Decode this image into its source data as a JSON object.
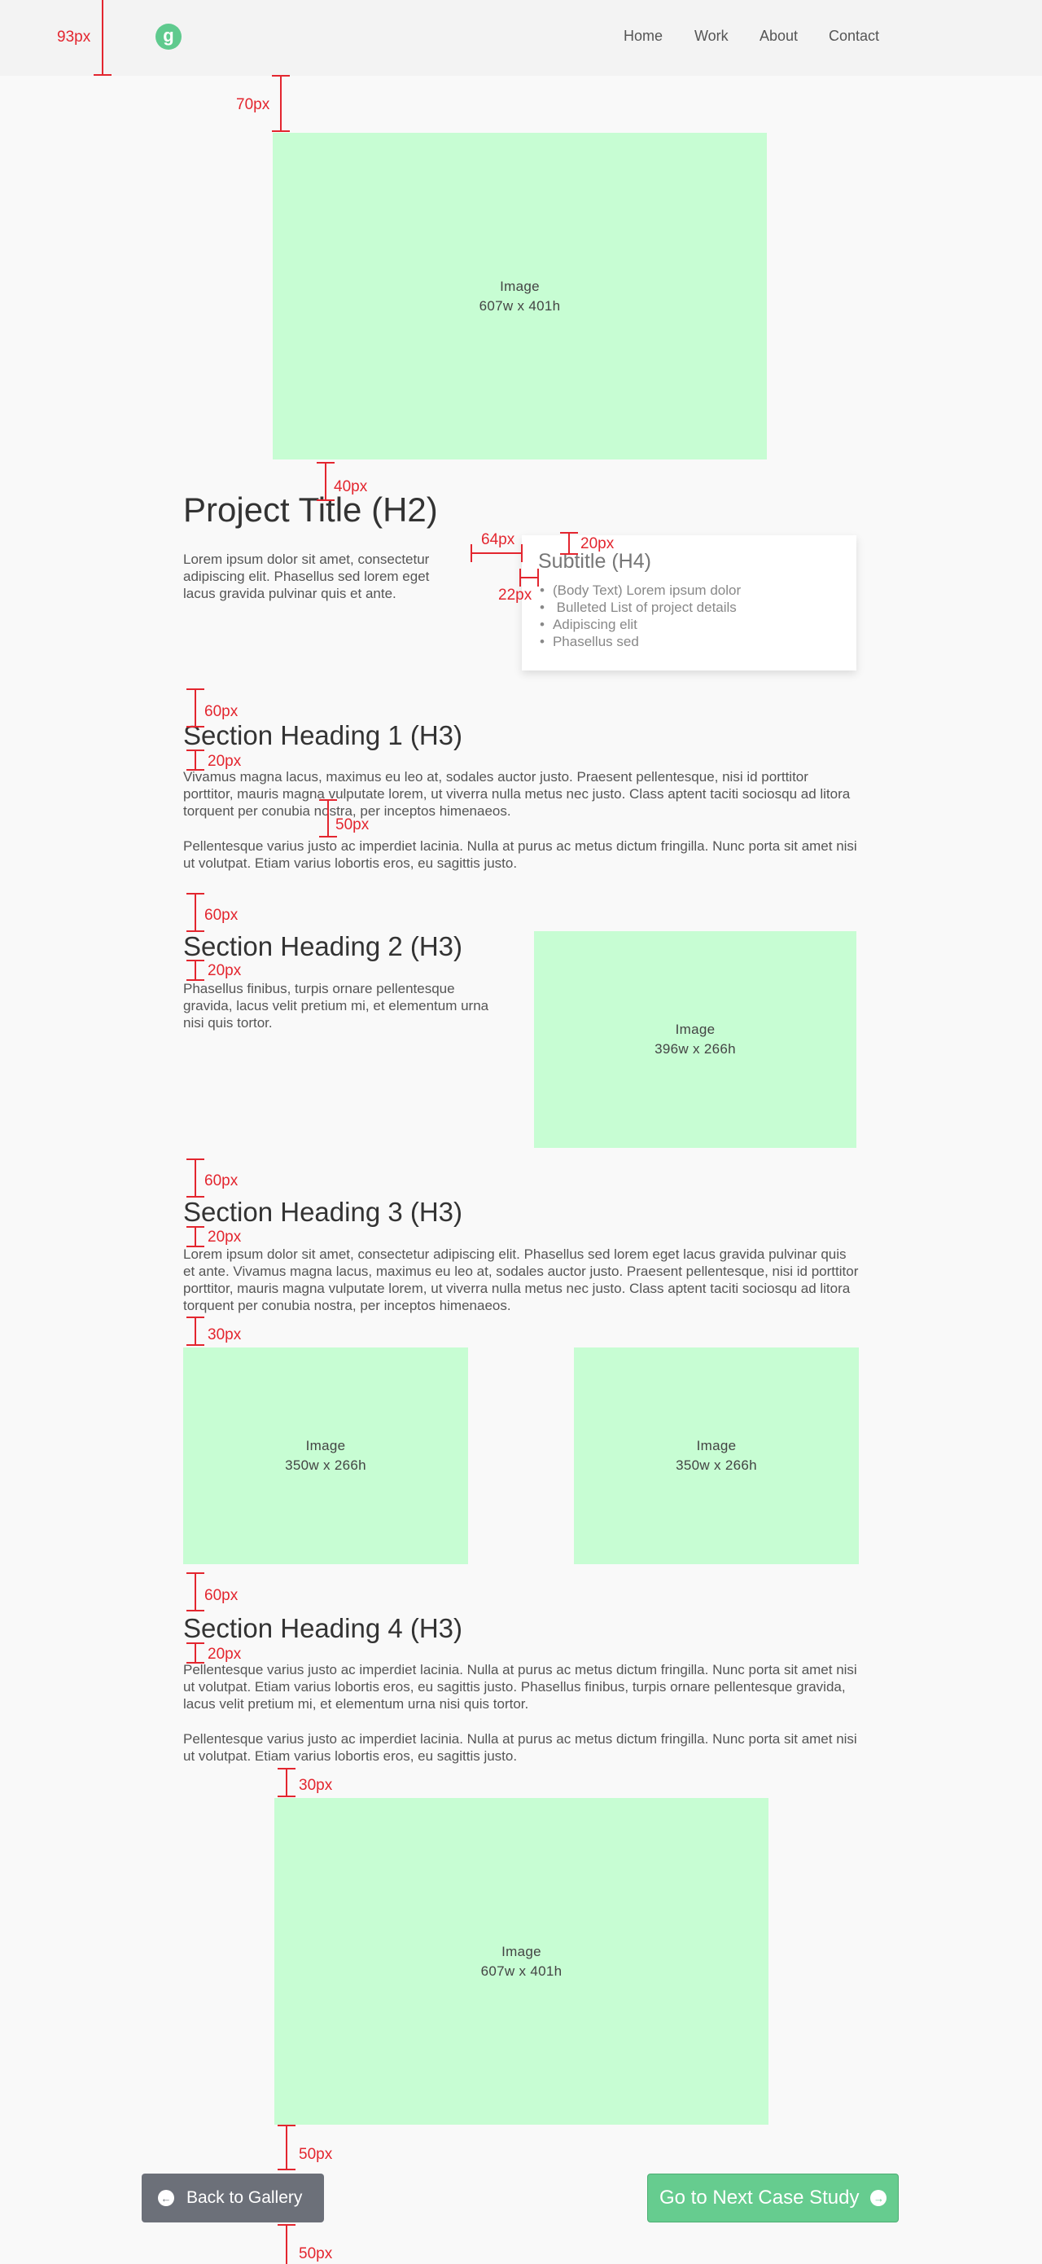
{
  "nav": {
    "logo": "g",
    "items": [
      "Home",
      "Work",
      "About",
      "Contact"
    ]
  },
  "images": {
    "hero": {
      "label": "Image",
      "dims": "607w x 401h"
    },
    "section2": {
      "label": "Image",
      "dims": "396w x 266h"
    },
    "section3_left": {
      "label": "Image",
      "dims": "350w x 266h"
    },
    "section3_right": {
      "label": "Image",
      "dims": "350w x 266h"
    },
    "section4": {
      "label": "Image",
      "dims": "607w x 401h"
    }
  },
  "project": {
    "title": "Project Title (H2)",
    "intro": "Lorem ipsum dolor sit amet, consectetur adipiscing elit. Phasellus sed lorem eget lacus gravida pulvinar quis et ante.",
    "card": {
      "subtitle": "Subtitle (H4)",
      "bullets": [
        "(Body Text) Lorem ipsum dolor",
        " Bulleted List of project details",
        "Adipiscing elit",
        "Phasellus sed"
      ]
    }
  },
  "sections": [
    {
      "heading": "Section Heading 1 (H3)",
      "p1": "Vivamus magna lacus, maximus eu leo at, sodales auctor justo. Praesent pellentesque, nisi id porttitor porttitor, mauris magna vulputate lorem, ut viverra nulla metus nec justo. Class aptent taciti sociosqu ad litora torquent per conubia nostra, per inceptos himenaeos.",
      "p2": "Pellentesque varius justo ac imperdiet lacinia. Nulla at purus ac metus dictum fringilla. Nunc porta sit amet nisi ut volutpat. Etiam varius lobortis eros, eu sagittis justo."
    },
    {
      "heading": "Section Heading 2 (H3)",
      "p1": "Phasellus finibus, turpis ornare pellentesque gravida, lacus velit pretium mi, et elementum urna nisi quis tortor."
    },
    {
      "heading": "Section Heading 3 (H3)",
      "p1": "Lorem ipsum dolor sit amet, consectetur adipiscing elit. Phasellus sed lorem eget lacus gravida pulvinar quis et ante. Vivamus magna lacus, maximus eu leo at, sodales auctor justo. Praesent pellentesque, nisi id porttitor porttitor, mauris magna vulputate lorem, ut viverra nulla metus nec justo. Class aptent taciti sociosqu ad litora torquent per conubia nostra, per inceptos himenaeos."
    },
    {
      "heading": "Section Heading 4 (H3)",
      "p1": "Pellentesque varius justo ac imperdiet lacinia. Nulla at purus ac metus dictum fringilla. Nunc porta sit amet nisi ut volutpat. Etiam varius lobortis eros, eu sagittis justo. Phasellus finibus, turpis ornare pellentesque gravida, lacus velit pretium mi, et elementum urna nisi quis tortor.",
      "p2": "Pellentesque varius justo ac imperdiet lacinia. Nulla at purus ac metus dictum fringilla. Nunc porta sit amet nisi ut volutpat. Etiam varius lobortis eros, eu sagittis justo."
    }
  ],
  "buttons": {
    "back": "Back to Gallery",
    "back_icon": "arrow-left-circle-icon",
    "next": "Go to Next Case Study",
    "next_icon": "arrow-right-circle-icon"
  },
  "measurements": {
    "m_93": "93px",
    "m_70": "70px",
    "m_40": "40px",
    "m_64": "64px",
    "m_20_card": "20px",
    "m_22": "22px",
    "m_60_s1": "60px",
    "m_20_s1": "20px",
    "m_50_s1": "50px",
    "m_60_s2": "60px",
    "m_20_s2": "20px",
    "m_60_s3": "60px",
    "m_20_s3": "20px",
    "m_30_s3": "30px",
    "m_60_s4": "60px",
    "m_20_s4": "20px",
    "m_30_s4": "30px",
    "m_50_btn": "50px",
    "m_50_bottom": "50px"
  },
  "colors": {
    "accent_green": "#66cc8f",
    "image_placeholder": "#c7fdd3",
    "annotation_red": "#e3262f",
    "back_button": "#6c7079"
  }
}
